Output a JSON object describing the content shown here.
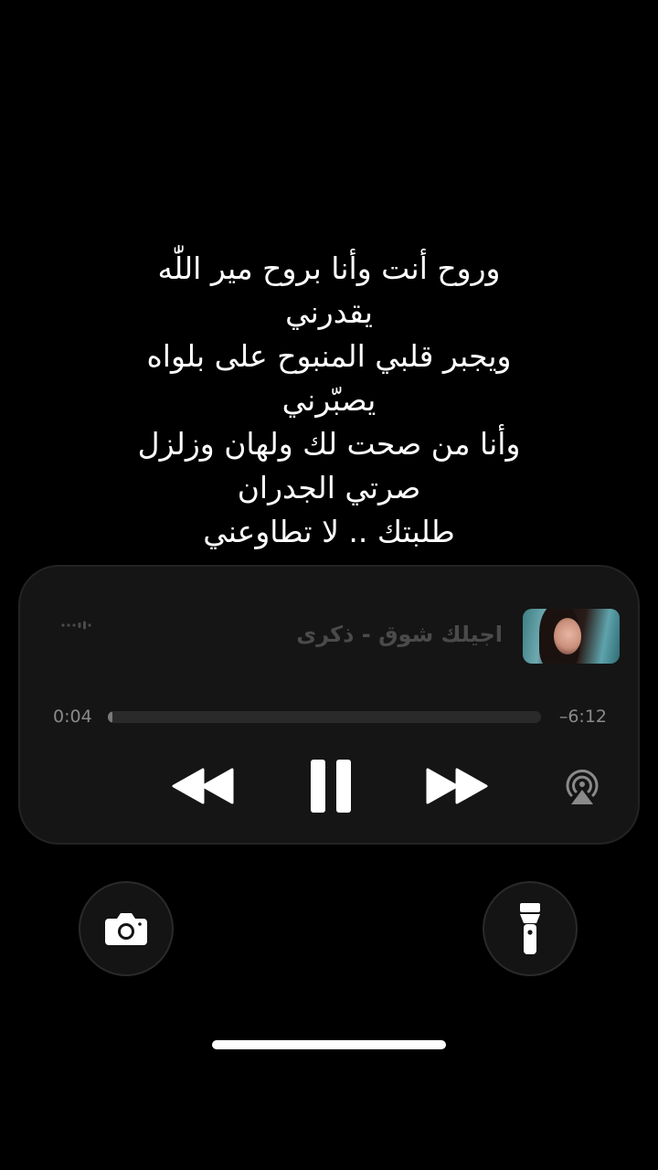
{
  "lyrics": {
    "lines": [
      "وروح أنت وأنا بروح مير اللّٰه",
      "يقدرني",
      "ويجبر قلبي المنبوح على بلواه",
      "يصبّرني",
      "وأنا من صحت لك ولهان وزلزل",
      "صرتي الجدران",
      "طلبتك .. لا تطاوعني"
    ]
  },
  "player": {
    "song_title": "اجيلك شوق - ذكرى",
    "time_elapsed": "0:04",
    "time_remaining": "–6:12",
    "progress_fraction": 0.011,
    "icons": {
      "audio_indicator": "audio-output-indicator-icon",
      "rewind": "rewind-icon",
      "pause": "pause-icon",
      "forward": "fast-forward-icon",
      "airplay": "airplay-icon"
    }
  },
  "quick_actions": {
    "camera_icon": "camera-icon",
    "flashlight_icon": "flashlight-icon"
  },
  "colors": {
    "background": "#000000",
    "player_bg": "#151515",
    "title_text": "#4a4a4a",
    "time_text": "#8a8a8a",
    "controls": "#ffffff"
  }
}
